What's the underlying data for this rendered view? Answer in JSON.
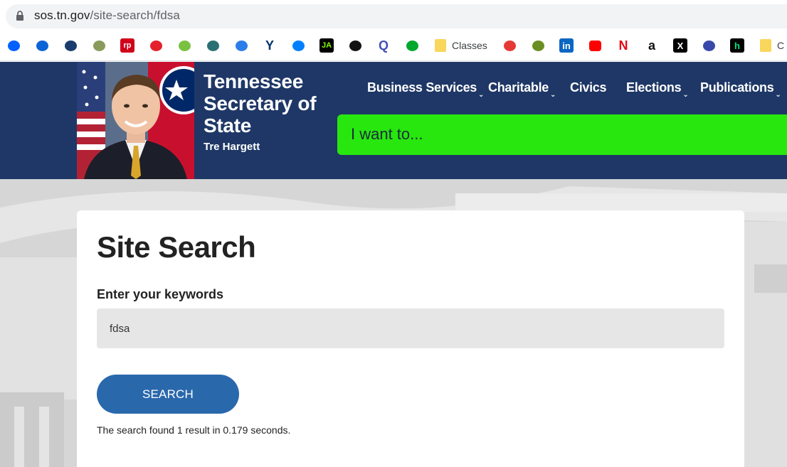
{
  "browser": {
    "url_domain": "sos.tn.gov",
    "url_path": "/site-search/fdsa"
  },
  "bookmarks": [
    {
      "name": "dropbox-icon",
      "glyph": "",
      "color": "#0061ff"
    },
    {
      "name": "onedrive-icon",
      "glyph": "",
      "color": "#0a64d6"
    },
    {
      "name": "arrow-up-icon",
      "glyph": "",
      "color": "#1a3c6e"
    },
    {
      "name": "tree-icon",
      "glyph": "",
      "color": "#8a9a5b"
    },
    {
      "name": "rp-icon",
      "glyph": "rp",
      "color": "#d0021b"
    },
    {
      "name": "swoosh-icon",
      "glyph": "",
      "color": "#e3202b"
    },
    {
      "name": "acorn-icon",
      "glyph": "",
      "color": "#7ac142"
    },
    {
      "name": "f-logo-icon",
      "glyph": "",
      "color": "#2a6f73"
    },
    {
      "name": "chat-icon",
      "glyph": "",
      "color": "#2b7de9"
    },
    {
      "name": "yale-icon",
      "glyph": "Y",
      "color": "#00356b"
    },
    {
      "name": "digitalocean-icon",
      "glyph": "",
      "color": "#0080ff"
    },
    {
      "name": "ja-icon",
      "glyph": "JA",
      "color": "#000000"
    },
    {
      "name": "github-icon",
      "glyph": "",
      "color": "#111111"
    },
    {
      "name": "q-icon",
      "glyph": "Q",
      "color": "#3f51b5"
    },
    {
      "name": "evernote-icon",
      "glyph": "",
      "color": "#00a82d"
    }
  ],
  "bookmarks_right": [
    {
      "name": "record-icon",
      "glyph": "",
      "color": "#e53935"
    },
    {
      "name": "badge-icon",
      "glyph": "",
      "color": "#6b8e23"
    },
    {
      "name": "linkedin-icon",
      "glyph": "in",
      "color": "#0a66c2"
    },
    {
      "name": "youtube-icon",
      "glyph": "",
      "color": "#ff0000"
    },
    {
      "name": "netflix-icon",
      "glyph": "N",
      "color": "#e50914"
    },
    {
      "name": "amazon-icon",
      "glyph": "a",
      "color": "#111111"
    },
    {
      "name": "x-icon",
      "glyph": "X",
      "color": "#000000"
    },
    {
      "name": "window-icon",
      "glyph": "",
      "color": "#3949ab"
    },
    {
      "name": "h-icon",
      "glyph": "h",
      "color": "#000000"
    }
  ],
  "bookmark_folders": [
    {
      "label": "Classes"
    },
    {
      "label": "C"
    }
  ],
  "site": {
    "title": "Tennessee Secretary of State",
    "subtitle": "Tre Hargett",
    "nav": [
      {
        "label": "Business Services",
        "has_dropdown": true
      },
      {
        "label": "Charitable",
        "has_dropdown": true
      },
      {
        "label": "Civics",
        "has_dropdown": false
      },
      {
        "label": "Elections",
        "has_dropdown": true
      },
      {
        "label": "Publications",
        "has_dropdown": true
      }
    ],
    "iwant_label": "I want to...",
    "header_color": "#1e3766",
    "accent_green": "#27e70e"
  },
  "search": {
    "heading": "Site Search",
    "field_label": "Enter your keywords",
    "query": "fdsa",
    "button_label": "SEARCH",
    "result_text": "The search found 1 result in 0.179 seconds.",
    "button_color": "#2a68ac"
  }
}
